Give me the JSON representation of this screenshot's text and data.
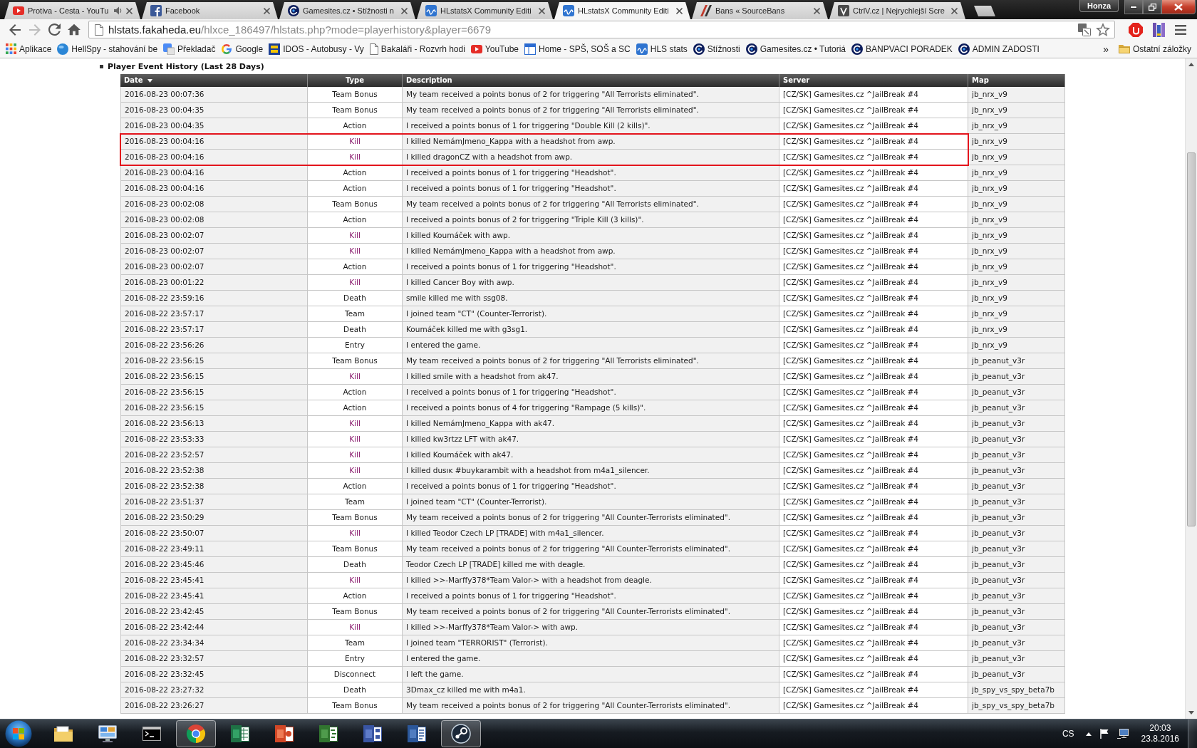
{
  "window": {
    "profile": "Honza"
  },
  "tabs": [
    {
      "title": "Protiva - Cesta - YouTu",
      "kind": "video",
      "audio": true,
      "selected": false
    },
    {
      "title": "Facebook",
      "kind": "social",
      "audio": false,
      "selected": false
    },
    {
      "title": "Gamesites.cz • Stížnosti n",
      "kind": "forum",
      "audio": false,
      "selected": false
    },
    {
      "title": "HLstatsX Community Editi",
      "kind": "stats",
      "audio": false,
      "selected": false
    },
    {
      "title": "HLstatsX Community Editi",
      "kind": "stats",
      "audio": false,
      "selected": true
    },
    {
      "title": "Bans « SourceBans",
      "kind": "bans",
      "audio": false,
      "selected": false
    },
    {
      "title": "CtrlV.cz | Nejrychlejší Scre",
      "kind": "screenshot",
      "audio": false,
      "selected": false
    }
  ],
  "toolbar": {
    "back_disabled": false,
    "forward_disabled": true,
    "url_host": "hlstats.fakaheda.eu",
    "url_path": "/hlxce_186497/hlstats.php?mode=playerhistory&player=6679"
  },
  "bookmarks": {
    "items": [
      {
        "label": "Aplikace",
        "kind": "apps"
      },
      {
        "label": "HellSpy - stahování be",
        "kind": "ball"
      },
      {
        "label": "Překladač",
        "kind": "translate"
      },
      {
        "label": "Google",
        "kind": "google"
      },
      {
        "label": "IDOS - Autobusy - Vy",
        "kind": "board"
      },
      {
        "label": "Bakaláři - Rozvrh hodi",
        "kind": "page"
      },
      {
        "label": "YouTube",
        "kind": "video"
      },
      {
        "label": "Home - SPŠ, SOŠ a SC",
        "kind": "window"
      },
      {
        "label": "HLS stats",
        "kind": "wave"
      },
      {
        "label": "Stížnosti",
        "kind": "swirl"
      },
      {
        "label": "Gamesites.cz • Tutoriá",
        "kind": "swirl"
      },
      {
        "label": "BANPVACI PORADEK",
        "kind": "swirl"
      },
      {
        "label": "ADMIN ZADOSTI",
        "kind": "swirl"
      }
    ],
    "overflow": "»",
    "other": "Ostatní záložky"
  },
  "page": {
    "heading": "Player Event History (Last 28 Days)",
    "table": {
      "columns": [
        {
          "label": "Date",
          "sorted": true
        },
        {
          "label": "Type",
          "sorted": false
        },
        {
          "label": "Description",
          "sorted": false
        },
        {
          "label": "Server",
          "sorted": false
        },
        {
          "label": "Map",
          "sorted": false
        }
      ],
      "rows": [
        {
          "date": "2016-08-23 00:07:36",
          "type": "Team Bonus",
          "kind": "event",
          "description": "My team received a points bonus of 2 for triggering \"All Terrorists eliminated\".",
          "server": "[CZ/SK] Gamesites.cz ^JailBreak #4",
          "map": "jb_nrx_v9",
          "marked": false
        },
        {
          "date": "2016-08-23 00:04:35",
          "type": "Team Bonus",
          "kind": "event",
          "description": "My team received a points bonus of 2 for triggering \"All Terrorists eliminated\".",
          "server": "[CZ/SK] Gamesites.cz ^JailBreak #4",
          "map": "jb_nrx_v9",
          "marked": false
        },
        {
          "date": "2016-08-23 00:04:35",
          "type": "Action",
          "kind": "event",
          "description": "I received a points bonus of 1 for triggering \"Double Kill (2 kills)\".",
          "server": "[CZ/SK] Gamesites.cz ^JailBreak #4",
          "map": "jb_nrx_v9",
          "marked": false
        },
        {
          "date": "2016-08-23 00:04:16",
          "type": "Kill",
          "kind": "kill",
          "description": "I killed NemámJmeno_Kappa with a headshot from awp.",
          "server": "[CZ/SK] Gamesites.cz ^JailBreak #4",
          "map": "jb_nrx_v9",
          "marked": true
        },
        {
          "date": "2016-08-23 00:04:16",
          "type": "Kill",
          "kind": "kill",
          "description": "I killed dragonCZ with a headshot from awp.",
          "server": "[CZ/SK] Gamesites.cz ^JailBreak #4",
          "map": "jb_nrx_v9",
          "marked": true
        },
        {
          "date": "2016-08-23 00:04:16",
          "type": "Action",
          "kind": "event",
          "description": "I received a points bonus of 1 for triggering \"Headshot\".",
          "server": "[CZ/SK] Gamesites.cz ^JailBreak #4",
          "map": "jb_nrx_v9",
          "marked": false
        },
        {
          "date": "2016-08-23 00:04:16",
          "type": "Action",
          "kind": "event",
          "description": "I received a points bonus of 1 for triggering \"Headshot\".",
          "server": "[CZ/SK] Gamesites.cz ^JailBreak #4",
          "map": "jb_nrx_v9",
          "marked": false
        },
        {
          "date": "2016-08-23 00:02:08",
          "type": "Team Bonus",
          "kind": "event",
          "description": "My team received a points bonus of 2 for triggering \"All Terrorists eliminated\".",
          "server": "[CZ/SK] Gamesites.cz ^JailBreak #4",
          "map": "jb_nrx_v9",
          "marked": false
        },
        {
          "date": "2016-08-23 00:02:08",
          "type": "Action",
          "kind": "event",
          "description": "I received a points bonus of 2 for triggering \"Triple Kill (3 kills)\".",
          "server": "[CZ/SK] Gamesites.cz ^JailBreak #4",
          "map": "jb_nrx_v9",
          "marked": false
        },
        {
          "date": "2016-08-23 00:02:07",
          "type": "Kill",
          "kind": "kill",
          "description": "I killed Koumáček with awp.",
          "server": "[CZ/SK] Gamesites.cz ^JailBreak #4",
          "map": "jb_nrx_v9",
          "marked": false
        },
        {
          "date": "2016-08-23 00:02:07",
          "type": "Kill",
          "kind": "kill",
          "description": "I killed NemámJmeno_Kappa with a headshot from awp.",
          "server": "[CZ/SK] Gamesites.cz ^JailBreak #4",
          "map": "jb_nrx_v9",
          "marked": false
        },
        {
          "date": "2016-08-23 00:02:07",
          "type": "Action",
          "kind": "event",
          "description": "I received a points bonus of 1 for triggering \"Headshot\".",
          "server": "[CZ/SK] Gamesites.cz ^JailBreak #4",
          "map": "jb_nrx_v9",
          "marked": false
        },
        {
          "date": "2016-08-23 00:01:22",
          "type": "Kill",
          "kind": "kill",
          "description": "I killed Cancer Boy with awp.",
          "server": "[CZ/SK] Gamesites.cz ^JailBreak #4",
          "map": "jb_nrx_v9",
          "marked": false
        },
        {
          "date": "2016-08-22 23:59:16",
          "type": "Death",
          "kind": "event",
          "description": "smile killed me with ssg08.",
          "server": "[CZ/SK] Gamesites.cz ^JailBreak #4",
          "map": "jb_nrx_v9",
          "marked": false
        },
        {
          "date": "2016-08-22 23:57:17",
          "type": "Team",
          "kind": "event",
          "description": "I joined team \"CT\" (Counter-Terrorist).",
          "server": "[CZ/SK] Gamesites.cz ^JailBreak #4",
          "map": "jb_nrx_v9",
          "marked": false
        },
        {
          "date": "2016-08-22 23:57:17",
          "type": "Death",
          "kind": "event",
          "description": "Koumáček killed me with g3sg1.",
          "server": "[CZ/SK] Gamesites.cz ^JailBreak #4",
          "map": "jb_nrx_v9",
          "marked": false
        },
        {
          "date": "2016-08-22 23:56:26",
          "type": "Entry",
          "kind": "event",
          "description": "I entered the game.",
          "server": "[CZ/SK] Gamesites.cz ^JailBreak #4",
          "map": "jb_nrx_v9",
          "marked": false
        },
        {
          "date": "2016-08-22 23:56:15",
          "type": "Team Bonus",
          "kind": "event",
          "description": "My team received a points bonus of 2 for triggering \"All Terrorists eliminated\".",
          "server": "[CZ/SK] Gamesites.cz ^JailBreak #4",
          "map": "jb_peanut_v3r",
          "marked": false
        },
        {
          "date": "2016-08-22 23:56:15",
          "type": "Kill",
          "kind": "kill",
          "description": "I killed smile with a headshot from ak47.",
          "server": "[CZ/SK] Gamesites.cz ^JailBreak #4",
          "map": "jb_peanut_v3r",
          "marked": false
        },
        {
          "date": "2016-08-22 23:56:15",
          "type": "Action",
          "kind": "event",
          "description": "I received a points bonus of 1 for triggering \"Headshot\".",
          "server": "[CZ/SK] Gamesites.cz ^JailBreak #4",
          "map": "jb_peanut_v3r",
          "marked": false
        },
        {
          "date": "2016-08-22 23:56:15",
          "type": "Action",
          "kind": "event",
          "description": "I received a points bonus of 4 for triggering \"Rampage (5 kills)\".",
          "server": "[CZ/SK] Gamesites.cz ^JailBreak #4",
          "map": "jb_peanut_v3r",
          "marked": false
        },
        {
          "date": "2016-08-22 23:56:13",
          "type": "Kill",
          "kind": "kill",
          "description": "I killed NemámJmeno_Kappa with ak47.",
          "server": "[CZ/SK] Gamesites.cz ^JailBreak #4",
          "map": "jb_peanut_v3r",
          "marked": false
        },
        {
          "date": "2016-08-22 23:53:33",
          "type": "Kill",
          "kind": "kill",
          "description": "I killed kw3rtzz LFT with ak47.",
          "server": "[CZ/SK] Gamesites.cz ^JailBreak #4",
          "map": "jb_peanut_v3r",
          "marked": false
        },
        {
          "date": "2016-08-22 23:52:57",
          "type": "Kill",
          "kind": "kill",
          "description": "I killed Koumáček with ak47.",
          "server": "[CZ/SK] Gamesites.cz ^JailBreak #4",
          "map": "jb_peanut_v3r",
          "marked": false
        },
        {
          "date": "2016-08-22 23:52:38",
          "type": "Kill",
          "kind": "kill",
          "description": "I killed dusıĸ #buykarambit with a headshot from m4a1_silencer.",
          "server": "[CZ/SK] Gamesites.cz ^JailBreak #4",
          "map": "jb_peanut_v3r",
          "marked": false
        },
        {
          "date": "2016-08-22 23:52:38",
          "type": "Action",
          "kind": "event",
          "description": "I received a points bonus of 1 for triggering \"Headshot\".",
          "server": "[CZ/SK] Gamesites.cz ^JailBreak #4",
          "map": "jb_peanut_v3r",
          "marked": false
        },
        {
          "date": "2016-08-22 23:51:37",
          "type": "Team",
          "kind": "event",
          "description": "I joined team \"CT\" (Counter-Terrorist).",
          "server": "[CZ/SK] Gamesites.cz ^JailBreak #4",
          "map": "jb_peanut_v3r",
          "marked": false
        },
        {
          "date": "2016-08-22 23:50:29",
          "type": "Team Bonus",
          "kind": "event",
          "description": "My team received a points bonus of 2 for triggering \"All Counter-Terrorists eliminated\".",
          "server": "[CZ/SK] Gamesites.cz ^JailBreak #4",
          "map": "jb_peanut_v3r",
          "marked": false
        },
        {
          "date": "2016-08-22 23:50:07",
          "type": "Kill",
          "kind": "kill",
          "description": "I killed Teodor Czech LP [TRADE] with m4a1_silencer.",
          "server": "[CZ/SK] Gamesites.cz ^JailBreak #4",
          "map": "jb_peanut_v3r",
          "marked": false
        },
        {
          "date": "2016-08-22 23:49:11",
          "type": "Team Bonus",
          "kind": "event",
          "description": "My team received a points bonus of 2 for triggering \"All Counter-Terrorists eliminated\".",
          "server": "[CZ/SK] Gamesites.cz ^JailBreak #4",
          "map": "jb_peanut_v3r",
          "marked": false
        },
        {
          "date": "2016-08-22 23:45:46",
          "type": "Death",
          "kind": "event",
          "description": "Teodor Czech LP [TRADE] killed me with deagle.",
          "server": "[CZ/SK] Gamesites.cz ^JailBreak #4",
          "map": "jb_peanut_v3r",
          "marked": false
        },
        {
          "date": "2016-08-22 23:45:41",
          "type": "Kill",
          "kind": "kill",
          "description": "I killed >>-Marffy378*Team Valor-> with a headshot from deagle.",
          "server": "[CZ/SK] Gamesites.cz ^JailBreak #4",
          "map": "jb_peanut_v3r",
          "marked": false
        },
        {
          "date": "2016-08-22 23:45:41",
          "type": "Action",
          "kind": "event",
          "description": "I received a points bonus of 1 for triggering \"Headshot\".",
          "server": "[CZ/SK] Gamesites.cz ^JailBreak #4",
          "map": "jb_peanut_v3r",
          "marked": false
        },
        {
          "date": "2016-08-22 23:42:45",
          "type": "Team Bonus",
          "kind": "event",
          "description": "My team received a points bonus of 2 for triggering \"All Counter-Terrorists eliminated\".",
          "server": "[CZ/SK] Gamesites.cz ^JailBreak #4",
          "map": "jb_peanut_v3r",
          "marked": false
        },
        {
          "date": "2016-08-22 23:42:44",
          "type": "Kill",
          "kind": "kill",
          "description": "I killed >>-Marffy378*Team Valor-> with awp.",
          "server": "[CZ/SK] Gamesites.cz ^JailBreak #4",
          "map": "jb_peanut_v3r",
          "marked": false
        },
        {
          "date": "2016-08-22 23:34:34",
          "type": "Team",
          "kind": "event",
          "description": "I joined team \"TERRORIST\" (Terrorist).",
          "server": "[CZ/SK] Gamesites.cz ^JailBreak #4",
          "map": "jb_peanut_v3r",
          "marked": false
        },
        {
          "date": "2016-08-22 23:32:57",
          "type": "Entry",
          "kind": "event",
          "description": "I entered the game.",
          "server": "[CZ/SK] Gamesites.cz ^JailBreak #4",
          "map": "jb_peanut_v3r",
          "marked": false
        },
        {
          "date": "2016-08-22 23:32:45",
          "type": "Disconnect",
          "kind": "event",
          "description": "I left the game.",
          "server": "[CZ/SK] Gamesites.cz ^JailBreak #4",
          "map": "jb_peanut_v3r",
          "marked": false
        },
        {
          "date": "2016-08-22 23:27:32",
          "type": "Death",
          "kind": "event",
          "description": "3Dmax_cz killed me with m4a1.",
          "server": "[CZ/SK] Gamesites.cz ^JailBreak #4",
          "map": "jb_spy_vs_spy_beta7b",
          "marked": false
        },
        {
          "date": "2016-08-22 23:26:27",
          "type": "Team Bonus",
          "kind": "event",
          "description": "My team received a points bonus of 2 for triggering \"All Counter-Terrorists eliminated\".",
          "server": "[CZ/SK] Gamesites.cz ^JailBreak #4",
          "map": "jb_spy_vs_spy_beta7b",
          "marked": false
        }
      ]
    }
  },
  "taskbar": {
    "apps": [
      {
        "kind": "folder",
        "running": false
      },
      {
        "kind": "panel",
        "running": false
      },
      {
        "kind": "console",
        "running": false
      },
      {
        "kind": "browser",
        "running": true
      },
      {
        "kind": "spreadsheet",
        "running": false
      },
      {
        "kind": "slides",
        "running": false
      },
      {
        "kind": "planner",
        "running": false
      },
      {
        "kind": "diagram",
        "running": false
      },
      {
        "kind": "document",
        "running": false
      },
      {
        "kind": "game",
        "running": true
      }
    ],
    "language": "CS",
    "time": "20:03",
    "date": "23.8.2016"
  }
}
